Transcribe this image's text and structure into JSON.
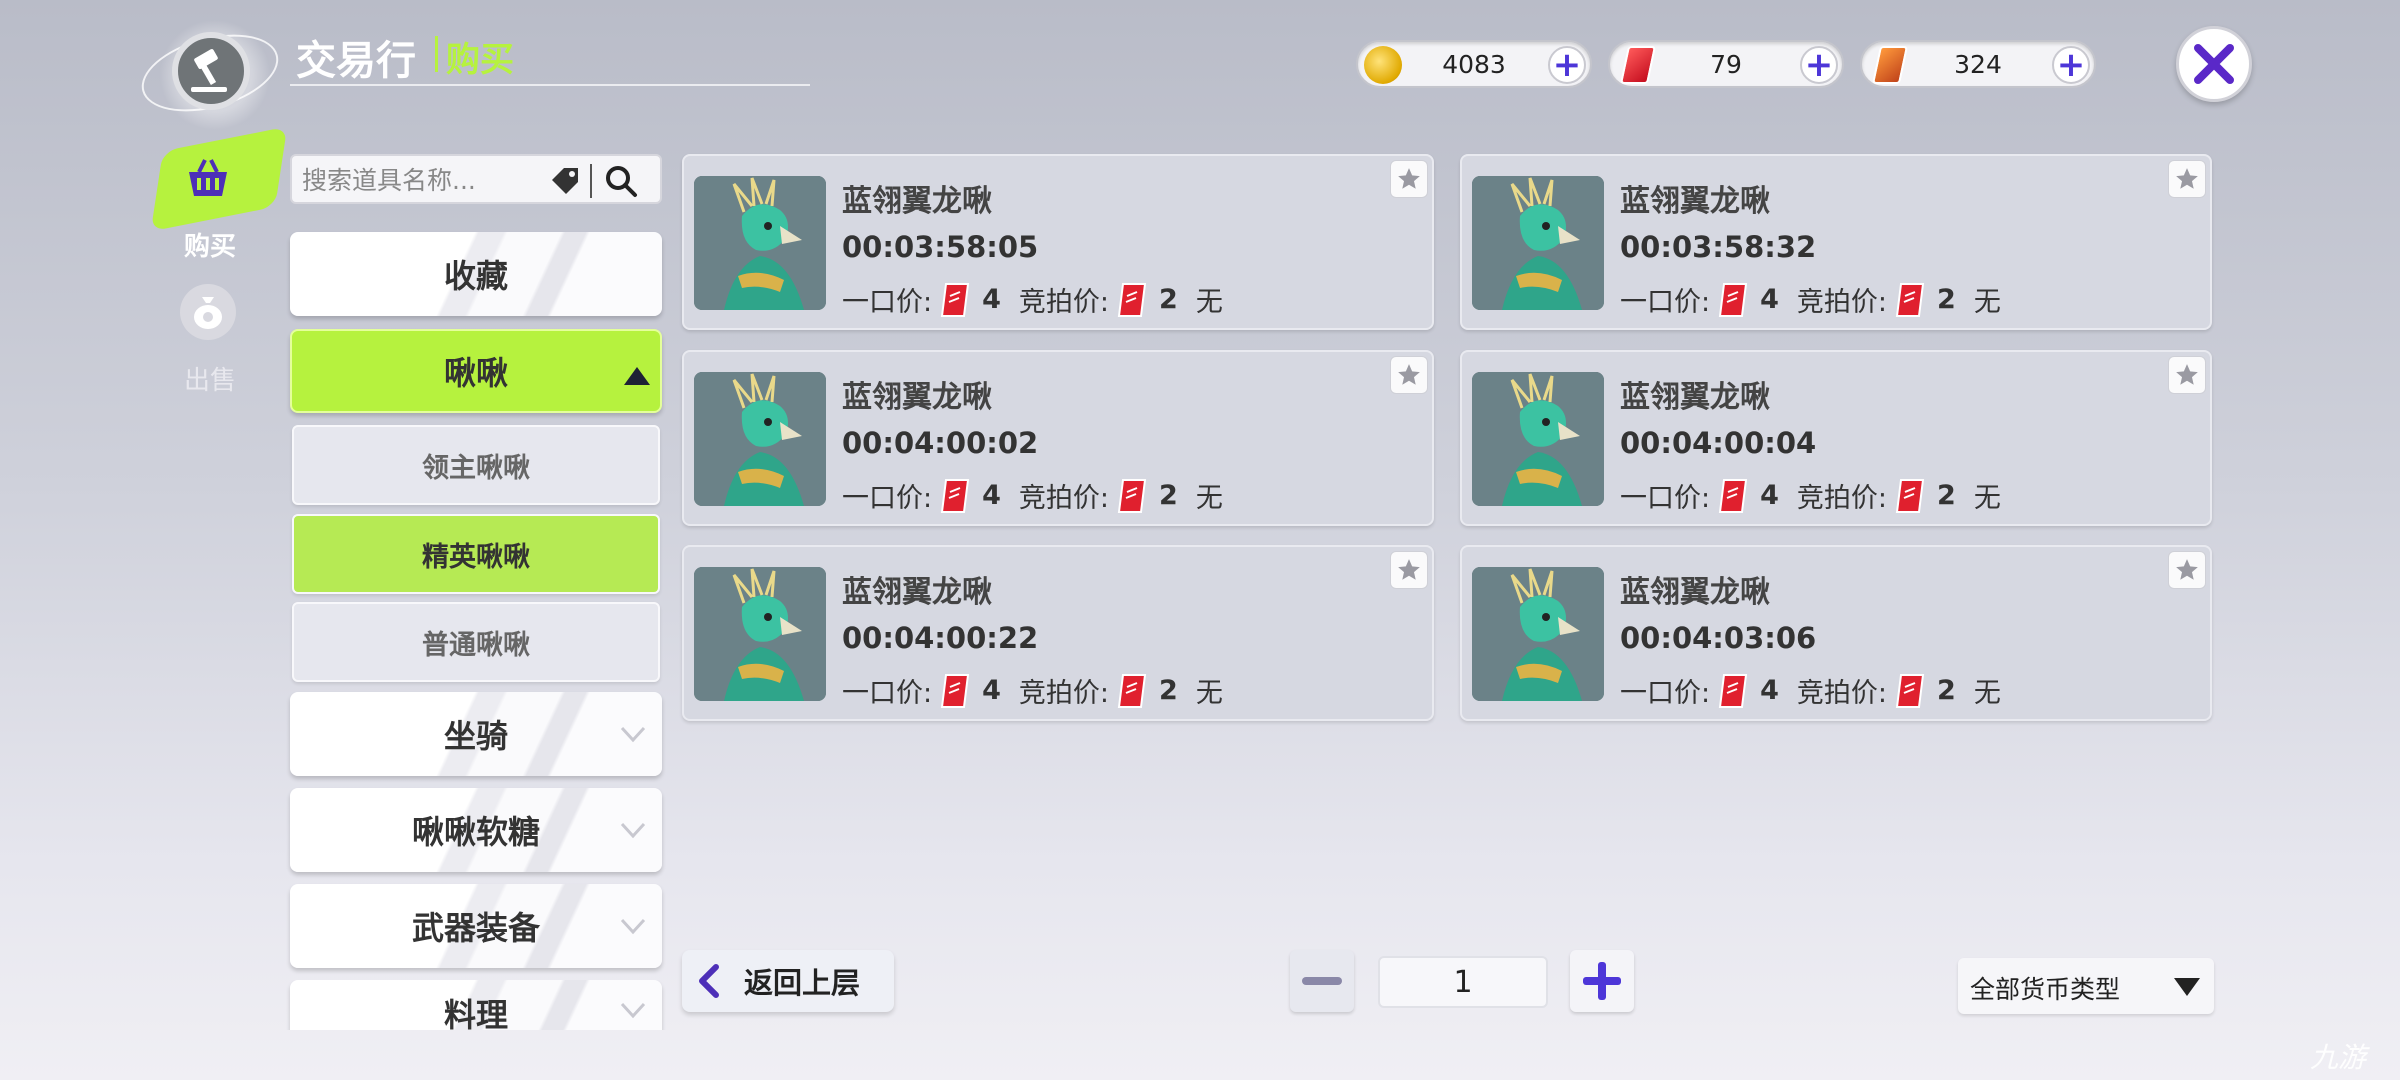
{
  "header": {
    "title": "交易行",
    "subtitle": "购买"
  },
  "currencies": [
    {
      "icon": "gold-coin-icon",
      "value": "4083"
    },
    {
      "icon": "red-ticket-icon",
      "value": "79"
    },
    {
      "icon": "orange-ticket-icon",
      "value": "324"
    }
  ],
  "nav": {
    "buy_label": "购买",
    "sell_label": "出售"
  },
  "search": {
    "placeholder": "搜索道具名称..."
  },
  "categories": {
    "favorites": "收藏",
    "pets": "啾啾",
    "pets_sub": [
      "领主啾啾",
      "精英啾啾",
      "普通啾啾"
    ],
    "mounts": "坐骑",
    "candy": "啾啾软糖",
    "weapons": "武器装备",
    "cooking": "料理"
  },
  "listings": [
    {
      "name": "蓝翎翼龙啾",
      "timer": "00:03:58:05",
      "buyout_label": "一口价:",
      "buyout": "4",
      "bid_label": "竞拍价:",
      "bid": "2",
      "bidder": "无"
    },
    {
      "name": "蓝翎翼龙啾",
      "timer": "00:03:58:32",
      "buyout_label": "一口价:",
      "buyout": "4",
      "bid_label": "竞拍价:",
      "bid": "2",
      "bidder": "无"
    },
    {
      "name": "蓝翎翼龙啾",
      "timer": "00:04:00:02",
      "buyout_label": "一口价:",
      "buyout": "4",
      "bid_label": "竞拍价:",
      "bid": "2",
      "bidder": "无"
    },
    {
      "name": "蓝翎翼龙啾",
      "timer": "00:04:00:04",
      "buyout_label": "一口价:",
      "buyout": "4",
      "bid_label": "竞拍价:",
      "bid": "2",
      "bidder": "无"
    },
    {
      "name": "蓝翎翼龙啾",
      "timer": "00:04:00:22",
      "buyout_label": "一口价:",
      "buyout": "4",
      "bid_label": "竞拍价:",
      "bid": "2",
      "bidder": "无"
    },
    {
      "name": "蓝翎翼龙啾",
      "timer": "00:04:03:06",
      "buyout_label": "一口价:",
      "buyout": "4",
      "bid_label": "竞拍价:",
      "bid": "2",
      "bidder": "无"
    }
  ],
  "footer": {
    "back_label": "返回上层",
    "page": "1",
    "currency_filter": "全部货币类型"
  },
  "watermark": "九游",
  "colors": {
    "accent_green": "#b6f23e",
    "ticket_red": "#e0202e",
    "close_purple": "#5a28c8"
  }
}
